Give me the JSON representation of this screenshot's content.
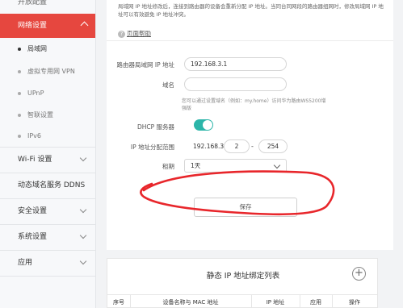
{
  "sidebar": {
    "top_partial": "开放配置",
    "active_section": "网络设置",
    "sub_items": [
      {
        "label": "局域网",
        "active": true
      },
      {
        "label": "虚拟专用网 VPN",
        "active": false
      },
      {
        "label": "UPnP",
        "active": false
      },
      {
        "label": "智联设置",
        "active": false
      },
      {
        "label": "IPv6",
        "active": false
      }
    ],
    "items": [
      {
        "label": "Wi-Fi 设置",
        "expandable": true
      },
      {
        "label": "动态域名服务 DDNS",
        "expandable": false
      },
      {
        "label": "安全设置",
        "expandable": true
      },
      {
        "label": "系统设置",
        "expandable": true
      },
      {
        "label": "应用",
        "expandable": true
      }
    ]
  },
  "lan": {
    "description": "局域网 IP 地址修改后，连接到路由器的设备会重新分配 IP 地址。当同台同网段的路由器组网时，修改局域网 IP 地址可以有效避免 IP 地址冲突。",
    "help_link": "页面帮助",
    "ip_label": "路由器局域网 IP 地址",
    "ip_value": "192.168.3.1",
    "domain_label": "域名",
    "domain_value": "",
    "domain_hint": "您可以通过设置域名（例如：my.home）访问华为路由WS5200增强版",
    "dhcp_label": "DHCP 服务器",
    "dhcp_enabled": true,
    "range_label": "IP 地址分配范围",
    "range_prefix": "192.168.3.",
    "range_start": "2",
    "range_sep": "-",
    "range_end": "254",
    "lease_label": "租期",
    "lease_value": "1天",
    "save_label": "保存"
  },
  "static_ip": {
    "title": "静态 IP 地址绑定列表",
    "add_icon": "plus",
    "columns": [
      "序号",
      "设备名称与 MAC 地址",
      "IP 地址",
      "应用",
      "操作"
    ]
  },
  "colors": {
    "accent": "#e6473f",
    "toggle_on": "#2cb5a9",
    "annotation": "#e8262b"
  }
}
